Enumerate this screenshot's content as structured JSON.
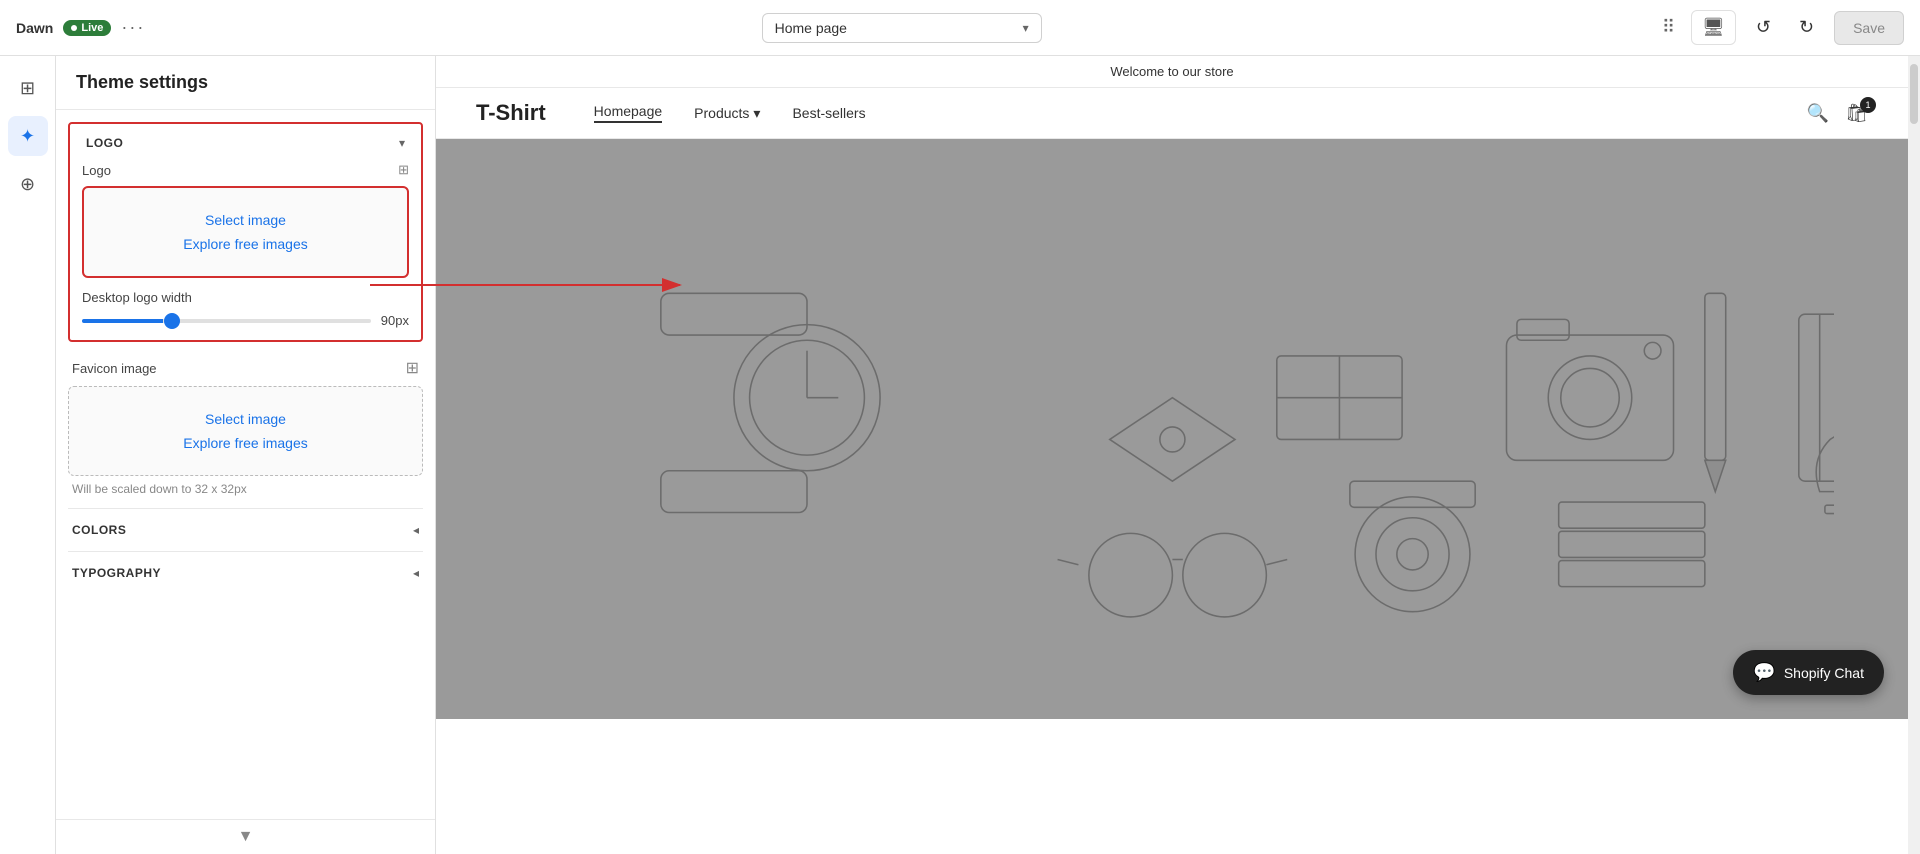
{
  "topbar": {
    "theme_name": "Dawn",
    "live_label": "Live",
    "more_options": "···",
    "page_selector": "Home page",
    "undo_label": "↺",
    "redo_label": "↻",
    "save_label": "Save"
  },
  "icon_sidebar": {
    "items": [
      {
        "name": "sections-icon",
        "label": "⊞",
        "active": false
      },
      {
        "name": "customize-icon",
        "label": "✦",
        "active": true
      },
      {
        "name": "add-section-icon",
        "label": "⊕",
        "active": false
      }
    ]
  },
  "settings": {
    "title": "Theme settings",
    "sections": {
      "logo": {
        "label": "LOGO",
        "subsections": {
          "logo": {
            "label": "Logo",
            "select_image": "Select image",
            "explore_images": "Explore free images"
          },
          "desktop_logo_width": {
            "label": "Desktop logo width",
            "value": 90,
            "unit": "px",
            "display": "90px"
          }
        }
      },
      "favicon": {
        "label": "Favicon image",
        "select_image": "Select image",
        "explore_images": "Explore free images",
        "note": "Will be scaled down to 32 x 32px"
      },
      "colors": {
        "label": "COLORS"
      },
      "typography": {
        "label": "TYPOGRAPHY"
      }
    }
  },
  "store_preview": {
    "announcement": "Welcome to our store",
    "logo": "T-Shirt",
    "nav": {
      "links": [
        {
          "label": "Homepage",
          "active": true
        },
        {
          "label": "Products",
          "has_arrow": true
        },
        {
          "label": "Best-sellers",
          "has_arrow": false
        }
      ]
    },
    "chat_widget": {
      "icon": "💬",
      "label": "Shopify Chat"
    }
  }
}
